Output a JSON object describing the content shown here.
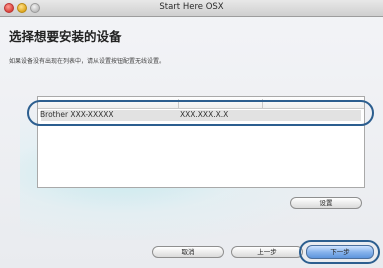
{
  "window": {
    "title": "Start Here OSX"
  },
  "page": {
    "heading": "选择想要安装的设备",
    "subtext": "如果设备没有出现在列表中，请从设置按钮配置无线设置。"
  },
  "device_list": {
    "rows": [
      {
        "name": "Brother XXX-XXXXX",
        "address": "XXX.XXX.X.X"
      }
    ]
  },
  "buttons": {
    "settings": "设置",
    "cancel": "取消",
    "back": "上一步",
    "next": "下一步"
  },
  "colors": {
    "highlight_ring": "#2c5e8f",
    "default_button": "#5d95dc"
  }
}
